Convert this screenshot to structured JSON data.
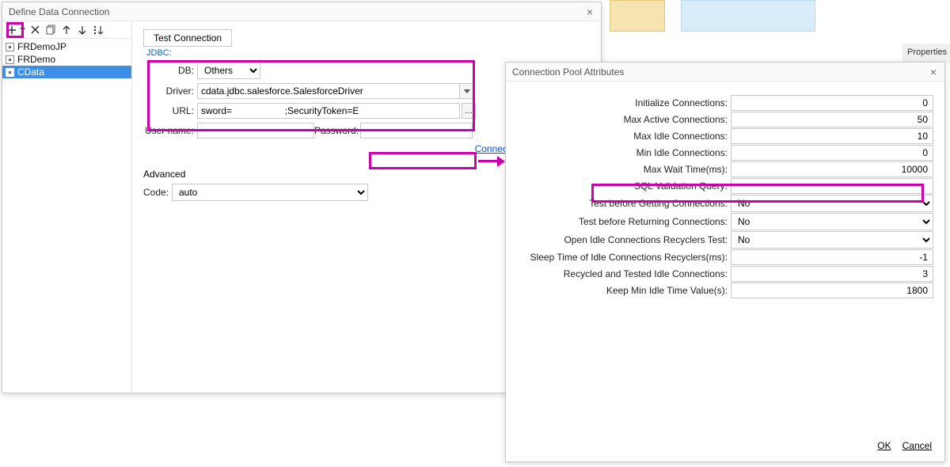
{
  "bg": {
    "properties_tab": "Properties"
  },
  "dialog1": {
    "title": "Define Data Connection",
    "tree": {
      "items": [
        "FRDemoJP",
        "FRDemo",
        "CData"
      ],
      "selected_index": 2
    },
    "test_button": "Test Connection",
    "jdbc_label": "JDBC:",
    "db": {
      "label": "DB:",
      "value": "Others"
    },
    "driver": {
      "label": "Driver:",
      "value": "cdata.jdbc.salesforce.SalesforceDriver"
    },
    "url": {
      "label": "URL:",
      "value": "sword=                    ;SecurityToken=E                                     U;",
      "more": "…"
    },
    "username": {
      "label": "User name:",
      "value": ""
    },
    "password": {
      "label": "Password:",
      "value": ""
    },
    "cpa_link": "Connection Pool Attributes",
    "advanced_label": "Advanced",
    "code": {
      "label": "Code:",
      "value": "auto"
    }
  },
  "dialog2": {
    "title": "Connection Pool Attributes",
    "rows": {
      "init_conn": {
        "label": "Initialize Connections:",
        "value": "0"
      },
      "max_active": {
        "label": "Max Active Connections:",
        "value": "50"
      },
      "max_idle": {
        "label": "Max Idle Connections:",
        "value": "10"
      },
      "min_idle": {
        "label": "Min Idle Connections:",
        "value": "0"
      },
      "max_wait": {
        "label": "Max Wait Time(ms):",
        "value": "10000"
      },
      "sql_valid": {
        "label": "SQL Validation Query:",
        "value": ""
      },
      "test_get": {
        "label": "Test before Getting Connections:",
        "value": "No"
      },
      "test_ret": {
        "label": "Test before Returning Connections:",
        "value": "No"
      },
      "open_rec": {
        "label": "Open Idle Connections Recyclers Test:",
        "value": "No"
      },
      "sleep_time": {
        "label": "Sleep Time of Idle Connections Recyclers(ms):",
        "value": "-1"
      },
      "rec_tested": {
        "label": "Recycled and Tested Idle Connections:",
        "value": "3"
      },
      "keep_min": {
        "label": "Keep Min Idle Time Value(s):",
        "value": "1800"
      }
    },
    "ok": "OK",
    "cancel": "Cancel"
  }
}
